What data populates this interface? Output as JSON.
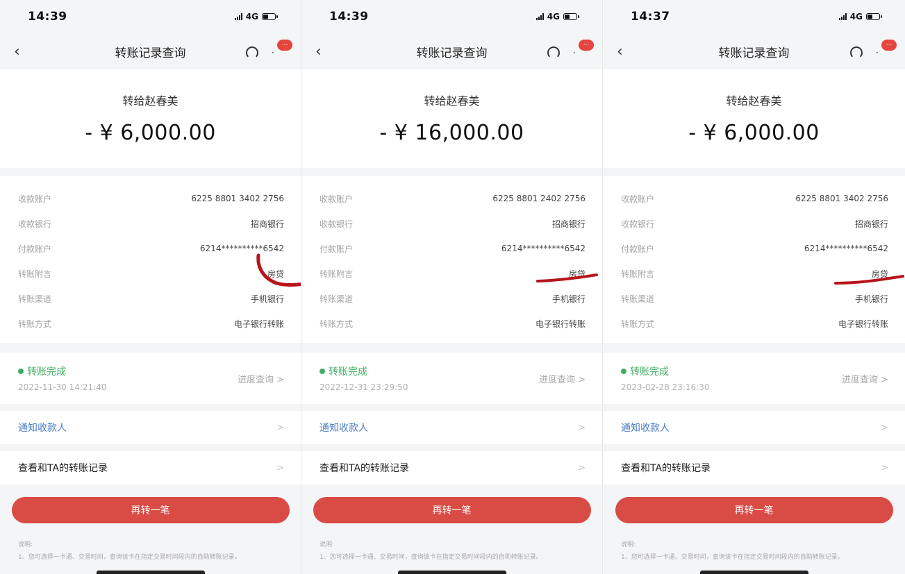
{
  "screenshots": [
    {
      "status_time": "14:39",
      "network": "4G",
      "nav_title": "转账记录查询",
      "payee_title": "转给赵春美",
      "amount": "- ¥ 6,000.00",
      "details": [
        {
          "label": "收款账户",
          "value": "6225 8801 3402 2756"
        },
        {
          "label": "收款银行",
          "value": "招商银行"
        },
        {
          "label": "付款账户",
          "value": "6214**********6542"
        },
        {
          "label": "转账附言",
          "value": "房贷"
        },
        {
          "label": "转账渠道",
          "value": "手机银行"
        },
        {
          "label": "转账方式",
          "value": "电子银行转账"
        }
      ],
      "status": "转账完成",
      "status_time_text": "2022-11-30 14:21:40",
      "progress_label": "进度查询 >",
      "notify_label": "通知收款人",
      "history_label": "查看和TA的转账记录",
      "chevron": ">",
      "again_label": "再转一笔",
      "notes_title": "说明:",
      "notes_text": "1、您可选择一卡通、交易时间，查询该卡在指定交易时间段内的自助转账记录。"
    },
    {
      "status_time": "14:39",
      "network": "4G",
      "nav_title": "转账记录查询",
      "payee_title": "转给赵春美",
      "amount": "- ¥ 16,000.00",
      "details": [
        {
          "label": "收款账户",
          "value": "6225 8801 2402 2756"
        },
        {
          "label": "收款银行",
          "value": "招商银行"
        },
        {
          "label": "付款账户",
          "value": "6214**********6542"
        },
        {
          "label": "转账附言",
          "value": "房贷"
        },
        {
          "label": "转账渠道",
          "value": "手机银行"
        },
        {
          "label": "转账方式",
          "value": "电子银行转账"
        }
      ],
      "status": "转账完成",
      "status_time_text": "2022-12-31 23:29:50",
      "progress_label": "进度查询 >",
      "notify_label": "通知收款人",
      "history_label": "查看和TA的转账记录",
      "chevron": ">",
      "again_label": "再转一笔",
      "notes_title": "说明:",
      "notes_text": "1、您可选择一卡通、交易时间，查询该卡在指定交易时间段内的自助转账记录。"
    },
    {
      "status_time": "14:37",
      "network": "4G",
      "nav_title": "转账记录查询",
      "payee_title": "转给赵春美",
      "amount": "- ¥ 6,000.00",
      "details": [
        {
          "label": "收款账户",
          "value": "6225 8801 3402 2756"
        },
        {
          "label": "收款银行",
          "value": "招商银行"
        },
        {
          "label": "付款账户",
          "value": "6214**********6542"
        },
        {
          "label": "转账附言",
          "value": "房贷"
        },
        {
          "label": "转账渠道",
          "value": "手机银行"
        },
        {
          "label": "转账方式",
          "value": "电子银行转账"
        }
      ],
      "status": "转账完成",
      "status_time_text": "2023-02-28 23:16:30",
      "progress_label": "进度查询 >",
      "notify_label": "通知收款人",
      "history_label": "查看和TA的转账记录",
      "chevron": ">",
      "again_label": "再转一笔",
      "notes_title": "说明:",
      "notes_text": "1、您可选择一卡通、交易时间，查询该卡在指定交易时间段内的自助转账记录。"
    }
  ],
  "colors": {
    "accent_red": "#d94b45",
    "status_green": "#3fae63",
    "link_blue": "#4d7fc6",
    "scribble_red": "#b8141c"
  }
}
